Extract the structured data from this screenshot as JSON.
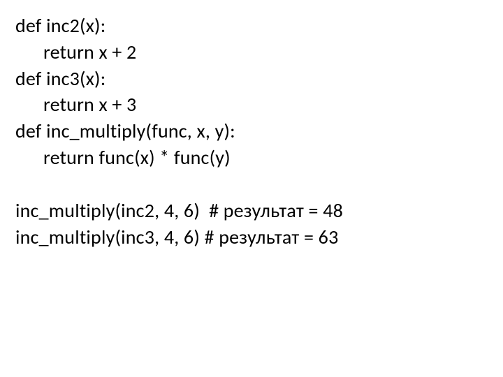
{
  "code": {
    "l1": "def inc2(x):",
    "l2": "return x + 2",
    "l3": "def inc3(x):",
    "l4": "return x + 3",
    "l5": "def inc_multiply(func, x, y):",
    "l6": "return func(x) * func(y)",
    "l7": "inc_multiply(inc2, 4, 6)  # результат = 48",
    "l8": "inc_multiply(inc3, 4, 6) # результат = 63"
  }
}
